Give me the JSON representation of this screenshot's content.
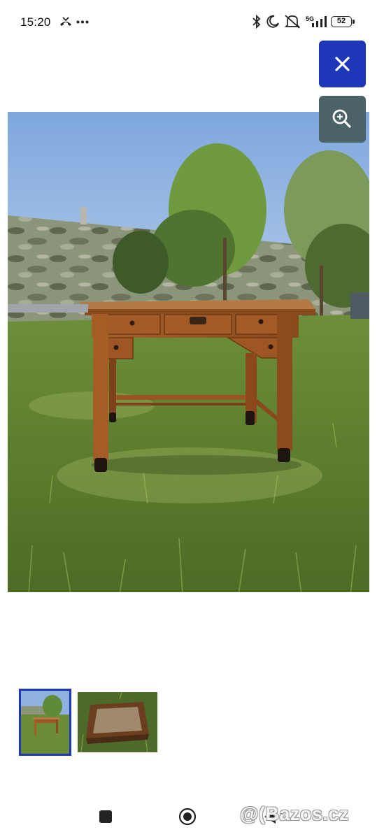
{
  "status_bar": {
    "time": "15:20",
    "battery": "52",
    "network": "5G",
    "icons": [
      "missed-call-icon",
      "more-dots-icon",
      "bluetooth-icon",
      "moon-icon",
      "mute-icon",
      "signal-icon",
      "battery-icon"
    ]
  },
  "overlay": {
    "close_icon": "close-icon",
    "zoom_icon": "zoom-in-icon",
    "close_color": "#1e37b8",
    "zoom_color": "#4b6266"
  },
  "thumbnails": [
    {
      "subject": "wooden desk on lawn",
      "selected": true
    },
    {
      "subject": "desk top close-up",
      "selected": false
    }
  ],
  "nav": {
    "icons": [
      "recents-square-icon",
      "home-circle-icon",
      "back-triangle-icon"
    ]
  },
  "watermark": {
    "text": "@(Bazos.cz"
  }
}
